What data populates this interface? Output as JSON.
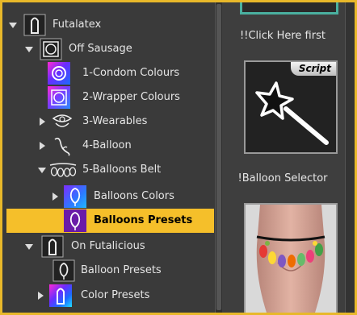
{
  "tree": {
    "items": [
      {
        "label": "Futalatex",
        "expanded": true,
        "icon": "condom-icon"
      },
      {
        "label": "Off Sausage",
        "expanded": true,
        "icon": "condom-wrapper-icon"
      },
      {
        "label": "1-Condom Colours",
        "icon": "condom-colours-icon"
      },
      {
        "label": "2-Wrapper Colours",
        "icon": "wrapper-colours-icon"
      },
      {
        "label": "3-Wearables",
        "expanded": false,
        "icon": "wearables-icon"
      },
      {
        "label": "4-Balloon",
        "expanded": false,
        "icon": "balloon-icon"
      },
      {
        "label": "5-Balloons Belt",
        "expanded": true,
        "icon": "balloons-belt-icon"
      },
      {
        "label": "Balloons Colors",
        "expanded": false,
        "icon": "balloons-colors-icon"
      },
      {
        "label": "Balloons Presets",
        "selected": true,
        "icon": "balloons-presets-icon"
      },
      {
        "label": "On Futalicious",
        "expanded": true,
        "icon": "condom-icon"
      },
      {
        "label": "Balloon Presets",
        "icon": "balloon-presets-icon"
      },
      {
        "label": "Color Presets",
        "expanded": false,
        "icon": "color-presets-icon"
      }
    ]
  },
  "presets": {
    "items": [
      {
        "label": "!!Click Here first",
        "badge": "Script",
        "icon": "magic-wand-icon"
      },
      {
        "label": "!Balloon Selector",
        "icon": "balloon-belt-preview"
      }
    ]
  },
  "colors": {
    "selected_row": "#f5bf2a",
    "accent_border": "#e8b82a",
    "panel_bg": "#3a3a3a"
  }
}
